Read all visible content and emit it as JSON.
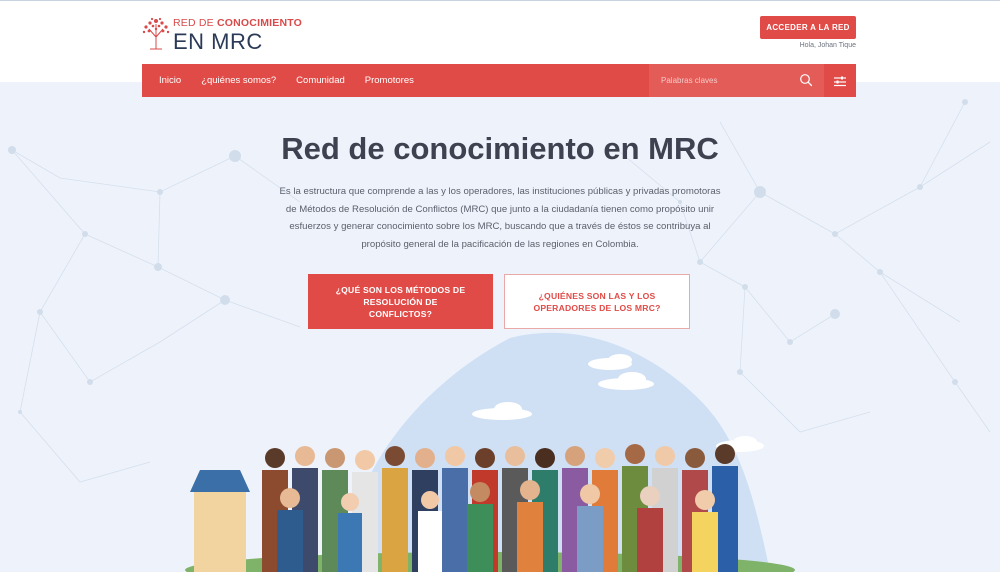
{
  "header": {
    "logo_line1_prefix": "RED DE",
    "logo_line1_bold": "CONOCIMIENTO",
    "logo_line2": "EN MRC",
    "access_button": "ACCEDER A LA RED",
    "greeting": "Hola, Johan Tique"
  },
  "nav": {
    "items": [
      {
        "label": "Inicio"
      },
      {
        "label": "¿quiénes somos?"
      },
      {
        "label": "Comunidad"
      },
      {
        "label": "Promotores"
      }
    ],
    "search_placeholder": "Palabras claves"
  },
  "hero": {
    "title": "Red de conocimiento en MRC",
    "description": "Es la estructura que comprende a las y los operadores, las instituciones públicas y privadas promotoras de Métodos de Resolución de Conflictos (MRC) que junto a la ciudadanía tienen como propósito unir esfuerzos y generar conocimiento sobre los MRC, buscando que a través de éstos se contribuya al propósito general de la pacificación de las regiones en Colombia.",
    "primary_button": "¿QUÉ SON LOS MÉTODOS DE RESOLUCIÓN DE CONFLICTOS?",
    "secondary_button": "¿QUIÉNES SON LAS Y LOS OPERADORES DE LOS MRC?"
  },
  "colors": {
    "accent": "#e04b47",
    "background": "#eef3fb",
    "title": "#3d4150"
  }
}
